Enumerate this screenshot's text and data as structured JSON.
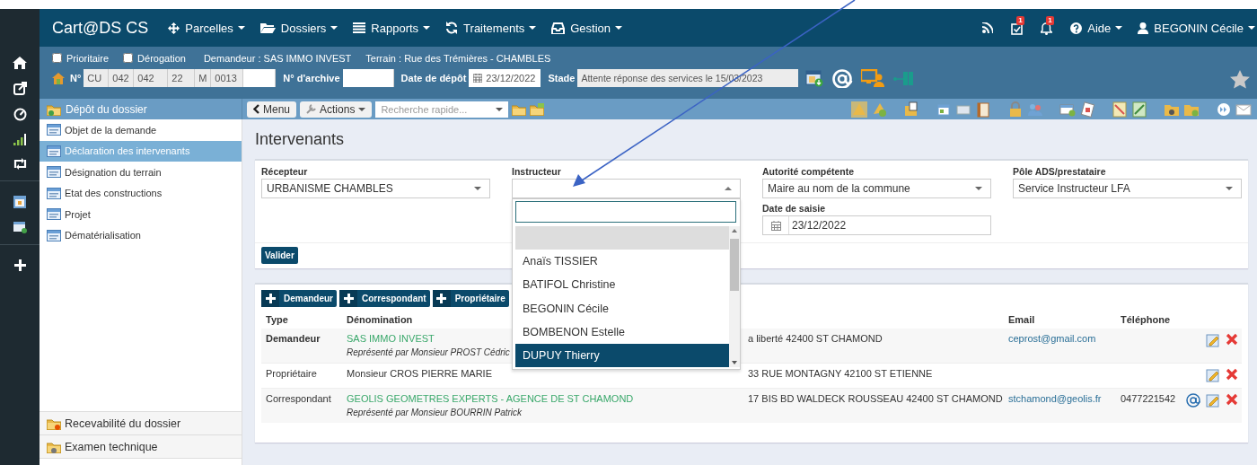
{
  "nav": {
    "brand": "Cart@DS CS",
    "menus": [
      "Parcelles",
      "Dossiers",
      "Rapports",
      "Traitements",
      "Gestion"
    ],
    "badges": [
      "1",
      "1"
    ],
    "help": "Aide",
    "user": "BEGONIN Cécile"
  },
  "header": {
    "flags": [
      {
        "label": "Prioritaire",
        "checked": false
      },
      {
        "label": "Dérogation",
        "checked": false
      }
    ],
    "demandeur": "Demandeur : SAS IMMO INVEST",
    "terrain": "Terrain : Rue des Trémières - CHAMBLES",
    "number_label": "N°",
    "number_parts": [
      "CU",
      "042",
      "042",
      "22",
      "M",
      "0013"
    ],
    "archive_label": "N° d'archive",
    "deposit_label": "Date de dépôt",
    "deposit_date": "23/12/2022",
    "stage_label": "Stade",
    "stage": "Attente réponse des services le 15/03/2023"
  },
  "toolbar": {
    "menu": "Menu",
    "actions": "Actions",
    "search_placeholder": "Recherche rapide..."
  },
  "sidebar": {
    "title": "Dépôt du dossier",
    "items": [
      {
        "label": "Objet de la demande",
        "selected": false
      },
      {
        "label": "Déclaration des intervenants",
        "selected": true
      },
      {
        "label": "Désignation du terrain",
        "selected": false
      },
      {
        "label": "Etat des constructions",
        "selected": false
      },
      {
        "label": "Projet",
        "selected": false
      },
      {
        "label": "Dématérialisation",
        "selected": false
      }
    ],
    "sections": [
      "Recevabilité du dossier",
      "Examen technique"
    ]
  },
  "page_title": "Intervenants",
  "form": {
    "fields": [
      {
        "kind": "select",
        "label": "Récepteur",
        "value": "URBANISME CHAMBLES",
        "open": false
      },
      {
        "kind": "select",
        "label": "Instructeur",
        "open": true
      },
      {
        "kind": "select",
        "label": "Autorité compétente",
        "value": "Maire au nom de la commune",
        "open": false
      },
      {
        "kind": "select",
        "label": "Pôle ADS/prestataire",
        "value": "Service Instructeur LFA",
        "open": false
      },
      {
        "kind": "date",
        "label": "Date de saisie",
        "value": "23/12/2022"
      }
    ],
    "submit": "Valider"
  },
  "dropdown": {
    "options": [
      {
        "selected": false,
        "hovered": true
      },
      {
        "label": "Anaïs TISSIER",
        "selected": false,
        "hovered": false
      },
      {
        "label": "BATIFOL Christine",
        "selected": false,
        "hovered": false
      },
      {
        "label": "BEGONIN Cécile",
        "selected": false,
        "hovered": false
      },
      {
        "label": "BOMBENON Estelle",
        "selected": false,
        "hovered": false
      },
      {
        "label": "DUPUY Thierry",
        "selected": true,
        "hovered": false
      }
    ]
  },
  "table": {
    "add_buttons": [
      "Demandeur",
      "Correspondant",
      "Propriétaire"
    ],
    "columns": [
      "Type",
      "Dénomination",
      "Email",
      "Téléphone"
    ],
    "rows": [
      {
        "type": "Demandeur",
        "primary": true,
        "name": "SAS IMMO INVEST",
        "linked": true,
        "representative": "Représenté par Monsieur PROST Cédric",
        "column_3": "a liberté 42400 ST CHAMOND",
        "email": "ceprost@gmail.com",
        "mail_action": false
      },
      {
        "type": "Propriétaire",
        "primary": false,
        "name": "Monsieur CROS PIERRE MARIE",
        "linked": false,
        "column_3": "33 RUE MONTAGNY 42100 ST ETIENNE",
        "mail_action": false
      },
      {
        "type": "Correspondant",
        "primary": false,
        "name": "GEOLIS GEOMETRES EXPERTS - AGENCE DE ST CHAMOND",
        "linked": true,
        "representative": "Représenté par Monsieur BOURRIN Patrick",
        "column_3": "17 BIS BD WALDECK ROUSSEAU 42400 ST CHAMOND",
        "email": "stchamond@geolis.fr",
        "phone": "0477221542",
        "mail_action": true
      }
    ]
  }
}
